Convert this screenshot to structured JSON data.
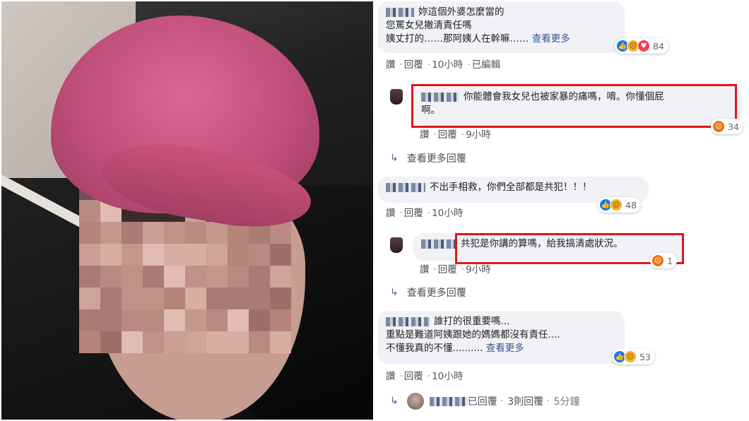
{
  "comments": [
    {
      "text_lines": [
        "妳這個外婆怎麼當的",
        "您罵女兒撇清責任嗎",
        "姨丈打的……那阿姨人在幹嘛……"
      ],
      "see_more": "查看更多",
      "actions": {
        "like": "讚",
        "reply": "回覆",
        "time": "10小時",
        "edited": "已編輯"
      },
      "reaction_count": "84"
    },
    {
      "text_lines": [
        "你能體會我女兒也被家暴的痛嗎，唷。你懂個屁",
        "啊。"
      ],
      "actions": {
        "like": "讚",
        "reply": "回覆",
        "time": "9小時"
      },
      "reaction_count": "34"
    },
    {
      "text_lines": [
        "不出手相救，你們全部都是共犯！！！"
      ],
      "actions": {
        "like": "讚",
        "reply": "回覆",
        "time": "10小時"
      },
      "reaction_count": "48"
    },
    {
      "text_lines": [
        "共犯是你講的算嗎，給我搞清處狀況。"
      ],
      "actions": {
        "like": "讚",
        "reply": "回覆",
        "time": "9小時"
      },
      "reaction_count": "1"
    },
    {
      "text_lines": [
        "誰打的很重要嗎...",
        "重點是難道阿姨跟她的媽媽都沒有責任....",
        "不懂我真的不懂.........."
      ],
      "see_more": "查看更多",
      "actions": {
        "like": "讚",
        "reply": "回覆",
        "time": "10小時"
      },
      "reaction_count": "53"
    }
  ],
  "view_more_replies": "查看更多回覆",
  "footer": {
    "replied": "已回覆",
    "reply_count": "3則回覆",
    "time": "5分鐘"
  },
  "colors": {
    "highlight": "#e0161b",
    "bubble": "#f0f2f5",
    "link": "#385898"
  }
}
